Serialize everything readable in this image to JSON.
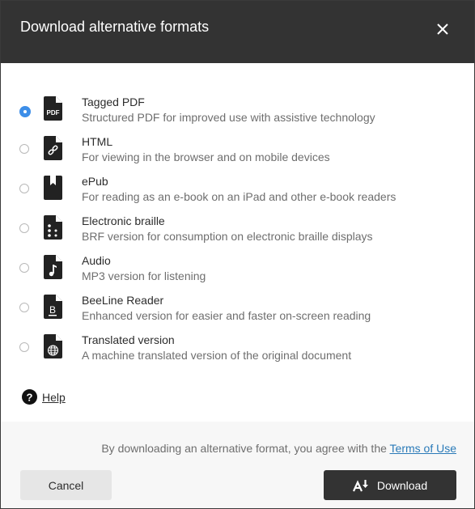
{
  "dialog": {
    "title": "Download alternative formats",
    "close_icon": "close-icon"
  },
  "options": [
    {
      "id": "tagged-pdf",
      "title": "Tagged PDF",
      "description": "Structured PDF for improved use with assistive technology",
      "icon": "pdf-file-icon",
      "icon_text": "PDF",
      "selected": true
    },
    {
      "id": "html",
      "title": "HTML",
      "description": "For viewing in the browser and on mobile devices",
      "icon": "link-file-icon",
      "selected": false
    },
    {
      "id": "epub",
      "title": "ePub",
      "description": "For reading as an e-book on an iPad and other e-book readers",
      "icon": "bookmark-book-icon",
      "selected": false
    },
    {
      "id": "electronic-braille",
      "title": "Electronic braille",
      "description": "BRF version for consumption on electronic braille displays",
      "icon": "braille-file-icon",
      "selected": false
    },
    {
      "id": "audio",
      "title": "Audio",
      "description": "MP3 version for listening",
      "icon": "music-file-icon",
      "selected": false
    },
    {
      "id": "beeline-reader",
      "title": "BeeLine Reader",
      "description": "Enhanced version for easier and faster on-screen reading",
      "icon": "beeline-file-icon",
      "icon_text": "B",
      "selected": false
    },
    {
      "id": "translated-version",
      "title": "Translated version",
      "description": "A machine translated version of the original document",
      "icon": "globe-file-icon",
      "selected": false
    }
  ],
  "help": {
    "label": "Help",
    "icon": "question-circle-icon"
  },
  "footer": {
    "terms_prefix": "By downloading an alternative format, you agree with the ",
    "terms_link": "Terms of Use",
    "cancel_label": "Cancel",
    "download_label": "Download",
    "download_icon": "download-format-icon"
  },
  "colors": {
    "header_bg": "#333333",
    "radio_selected": "#3d8ee8",
    "link": "#2a7ab8",
    "footer_bg": "#f7f7f7",
    "primary_button": "#333333",
    "secondary_button": "#e6e6e6"
  }
}
